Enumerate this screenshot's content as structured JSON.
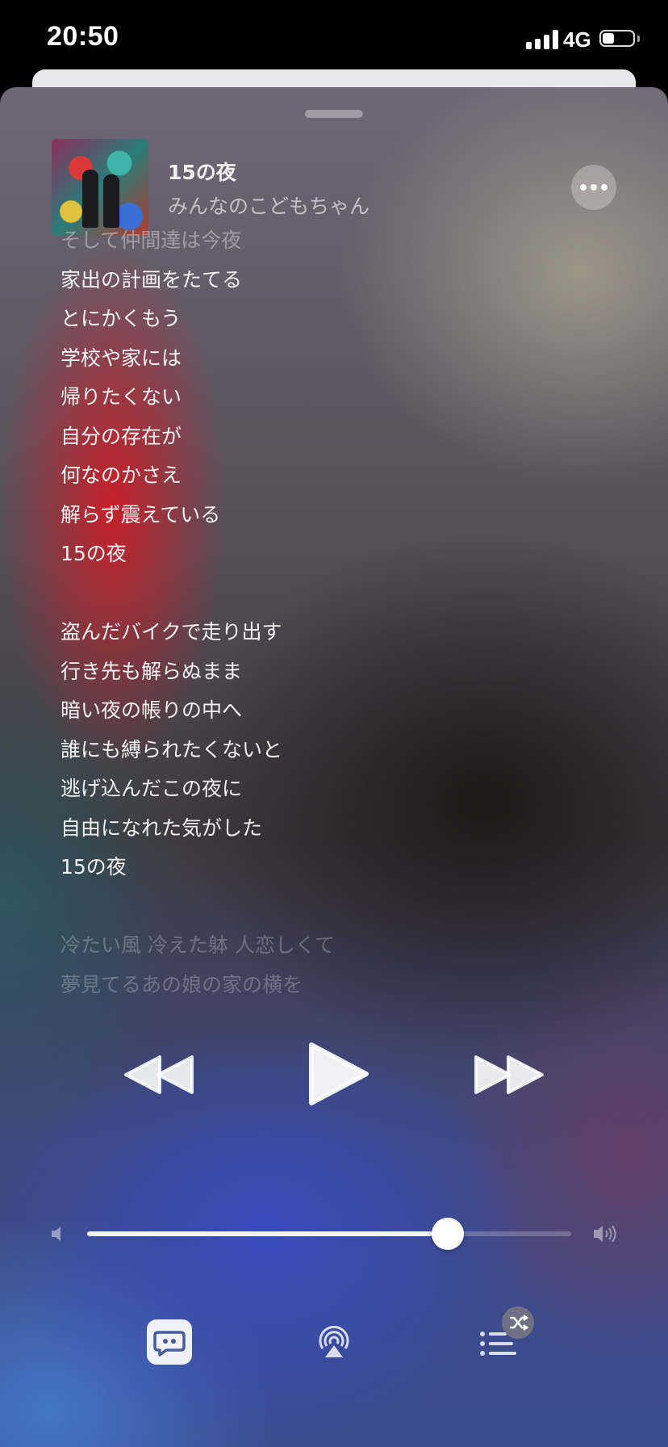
{
  "status_bar": {
    "time": "20:50",
    "network": "4G",
    "battery_level": 0.4,
    "signal_bars": 4
  },
  "player": {
    "track_title": "15の夜",
    "artist": "みんなのこどもちゃん",
    "more_icon": "ellipsis-icon",
    "album_art_icon": "album-art"
  },
  "lyrics": [
    "そして仲間達は今夜",
    "家出の計画をたてる",
    "とにかくもう",
    "学校や家には",
    "帰りたくない",
    "自分の存在が",
    "何なのかさえ",
    "解らず震えている",
    "15の夜",
    "",
    "盗んだバイクで走り出す",
    "行き先も解らぬまま",
    "暗い夜の帳りの中へ",
    "誰にも縛られたくないと",
    "逃げ込んだこの夜に",
    "自由になれた気がした",
    "15の夜",
    "",
    "冷たい風 冷えた躰 人恋しくて",
    "夢見てるあの娘の家の横を"
  ],
  "controls": {
    "previous_icon": "backward-icon",
    "play_icon": "play-icon",
    "next_icon": "forward-icon"
  },
  "volume": {
    "level": 0.745,
    "min_icon": "speaker-low-icon",
    "max_icon": "speaker-high-icon"
  },
  "bottom_bar": {
    "lyrics_icon": "lyrics-quote-icon",
    "airplay_icon": "airplay-icon",
    "queue_icon": "queue-list-icon",
    "shuffle_icon": "shuffle-icon"
  },
  "colors": {
    "accent_lyrics_button": "#ffffff"
  }
}
